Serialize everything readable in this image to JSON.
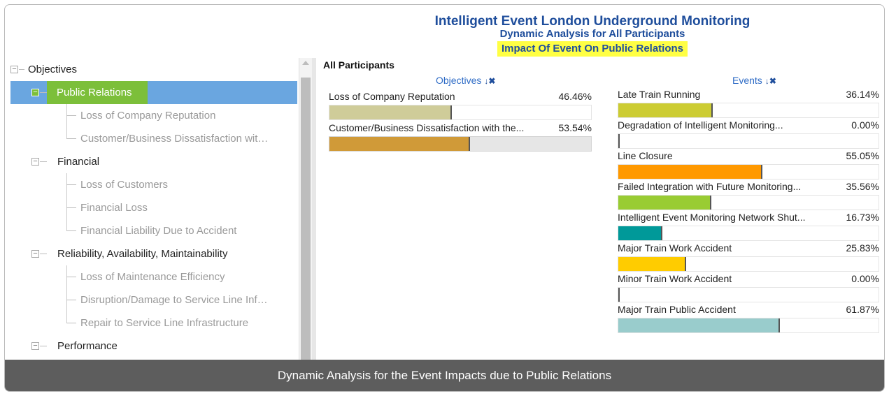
{
  "header": {
    "title": "Intelligent Event London Underground Monitoring",
    "subtitle": "Dynamic Analysis for All Participants",
    "highlight": "Impact Of Event On Public Relations"
  },
  "tree": {
    "root": "Objectives",
    "groups": [
      {
        "label": "Public Relations",
        "selected": true,
        "items": [
          "Loss of Company Reputation",
          "Customer/Business Dissatisfaction wit…"
        ]
      },
      {
        "label": "Financial",
        "items": [
          "Loss of Customers",
          "Financial Loss",
          "Financial Liability Due to Accident"
        ]
      },
      {
        "label": "Reliability, Availability, Maintainability",
        "items": [
          "Loss of Maintenance Efficiency",
          "Disruption/Damage to Service Line Inf…",
          "Repair to Service Line Infrastructure"
        ]
      },
      {
        "label": "Performance",
        "items": []
      }
    ]
  },
  "panel": {
    "heading": "All Participants",
    "objectives_header": "Objectives",
    "events_header": "Events"
  },
  "objectives": [
    {
      "label": "Loss of Company Reputation",
      "value": "46.46%",
      "pct": 46.46,
      "color": "#cfcc99"
    },
    {
      "label": "Customer/Business Dissatisfaction with the...",
      "value": "53.54%",
      "pct": 53.54,
      "color": "#d09a38"
    }
  ],
  "events": [
    {
      "label": "Late Train Running",
      "value": "36.14%",
      "pct": 36.14,
      "color": "#cccc33"
    },
    {
      "label": "Degradation of Intelligent Monitoring...",
      "value": "0.00%",
      "pct": 0,
      "color": "#cccccc"
    },
    {
      "label": "Line Closure",
      "value": "55.05%",
      "pct": 55.05,
      "color": "#ff9900"
    },
    {
      "label": "Failed Integration with Future Monitoring...",
      "value": "35.56%",
      "pct": 35.56,
      "color": "#99cc33"
    },
    {
      "label": "Intelligent Event Monitoring Network Shut...",
      "value": "16.73%",
      "pct": 16.73,
      "color": "#009999"
    },
    {
      "label": "Major Train Work Accident",
      "value": "25.83%",
      "pct": 25.83,
      "color": "#ffcc00"
    },
    {
      "label": "Minor Train Work Accident",
      "value": "0.00%",
      "pct": 0,
      "color": "#cccccc"
    },
    {
      "label": "Major Train Public Accident",
      "value": "61.87%",
      "pct": 61.87,
      "color": "#99cccc"
    }
  ],
  "caption": "Dynamic Analysis for the Event Impacts due to Public Relations"
}
